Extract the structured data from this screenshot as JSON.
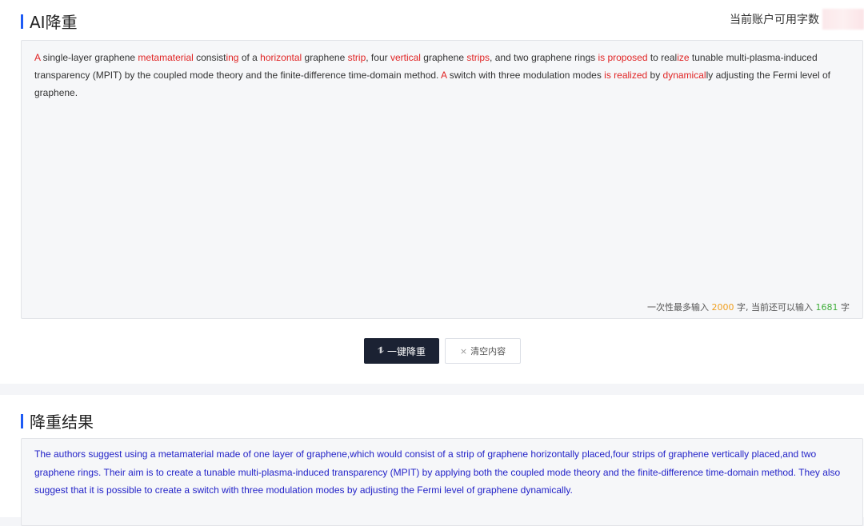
{
  "top_section": {
    "title": "AI降重",
    "quota_label": "当前账户可用字数"
  },
  "input": {
    "segments": [
      {
        "text": "A",
        "hl": true
      },
      {
        "text": " single-layer graphene ",
        "hl": false
      },
      {
        "text": "metamaterial",
        "hl": true
      },
      {
        "text": " consist",
        "hl": false
      },
      {
        "text": "ing",
        "hl": true
      },
      {
        "text": " of a ",
        "hl": false
      },
      {
        "text": "horizontal",
        "hl": true
      },
      {
        "text": " graphene ",
        "hl": false
      },
      {
        "text": "strip",
        "hl": true
      },
      {
        "text": ", four ",
        "hl": false
      },
      {
        "text": "vertical",
        "hl": true
      },
      {
        "text": " graphene ",
        "hl": false
      },
      {
        "text": "strips",
        "hl": true
      },
      {
        "text": ", and two graphene rings ",
        "hl": false
      },
      {
        "text": "is proposed",
        "hl": true
      },
      {
        "text": " to real",
        "hl": false
      },
      {
        "text": "ize",
        "hl": true
      },
      {
        "text": " tunable multi-plasma-induced transparency (MPIT) by the coupled mode theory and the finite-difference time-domain method. ",
        "hl": false
      },
      {
        "text": "A",
        "hl": true
      },
      {
        "text": " switch with three modulation modes ",
        "hl": false
      },
      {
        "text": "is realized",
        "hl": true
      },
      {
        "text": " by ",
        "hl": false
      },
      {
        "text": "dynamical",
        "hl": true
      },
      {
        "text": "ly adjusting the Fermi level of graphene.",
        "hl": false
      }
    ],
    "counter": {
      "prefix": "一次性最多输入",
      "max": "2000",
      "middle": "字, 当前还可以输入",
      "remaining": "1681",
      "suffix": "字"
    }
  },
  "buttons": {
    "rewrite_icon": "⥮",
    "rewrite_label": "一键降重",
    "clear_icon": "×",
    "clear_label": "清空内容"
  },
  "result_section": {
    "title": "降重结果",
    "text": "The authors suggest using a metamaterial made of one layer of graphene,which would consist of a strip of graphene horizontally placed,four strips of graphene vertically placed,and two graphene rings. Their aim is to create a tunable multi-plasma-induced transparency (MPIT) by applying both the coupled mode theory and the finite-difference time-domain method. They also suggest that it is possible to create a switch with three modulation modes by adjusting the Fermi level of graphene dynamically."
  },
  "colors": {
    "accent": "#1e5bf5",
    "highlight": "#e02424",
    "result_text": "#2323c8",
    "primary_button": "#1b2233"
  }
}
